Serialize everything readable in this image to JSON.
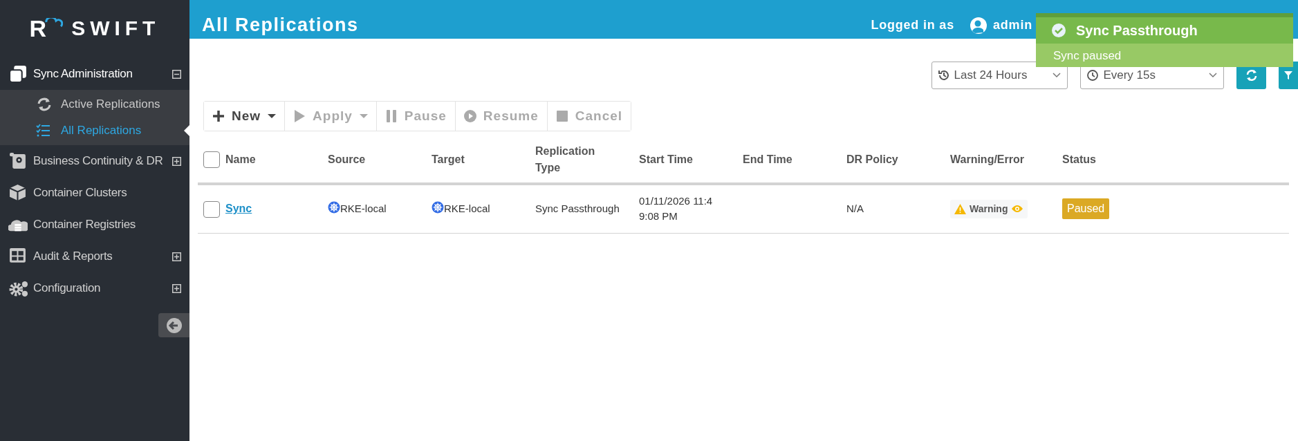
{
  "sidebar": {
    "logo": {
      "mark": "R",
      "name": "SWIFT"
    },
    "items": [
      {
        "label": "Sync Administration",
        "expanded": true,
        "children": [
          {
            "label": "Active Replications",
            "selected": false
          },
          {
            "label": "All Replications",
            "selected": true
          }
        ]
      },
      {
        "label": "Business Continuity & DR",
        "expanded": false
      },
      {
        "label": "Container Clusters"
      },
      {
        "label": "Container Registries"
      },
      {
        "label": "Audit & Reports",
        "expanded": false
      },
      {
        "label": "Configuration",
        "expanded": false
      }
    ]
  },
  "header": {
    "title": "All Replications",
    "login_label": "Logged in as",
    "user": "admin"
  },
  "toast": {
    "title": "Sync Passthrough",
    "message": "Sync paused"
  },
  "filters": {
    "time_range": "Last 24 Hours",
    "refresh_interval": "Every 15s"
  },
  "toolbar": [
    {
      "label": "New",
      "disabled": false,
      "dropdown": true
    },
    {
      "label": "Apply",
      "disabled": true,
      "dropdown": true
    },
    {
      "label": "Pause",
      "disabled": true,
      "dropdown": false
    },
    {
      "label": "Resume",
      "disabled": true,
      "dropdown": false
    },
    {
      "label": "Cancel",
      "disabled": true,
      "dropdown": false
    }
  ],
  "table": {
    "columns": [
      "Name",
      "Source",
      "Target",
      "Replication Type",
      "Start Time",
      "End Time",
      "DR Policy",
      "Warning/Error",
      "Status"
    ],
    "all_checked": false,
    "rows": [
      {
        "checked": false,
        "name": "Sync",
        "source": "RKE-local",
        "target": "RKE-local",
        "replication_type": "Sync Passthrough",
        "start_time": "01/11/2026 11:49:08 PM",
        "dr_policy": "N/A",
        "warning": "Warning",
        "status": "Paused"
      }
    ]
  }
}
